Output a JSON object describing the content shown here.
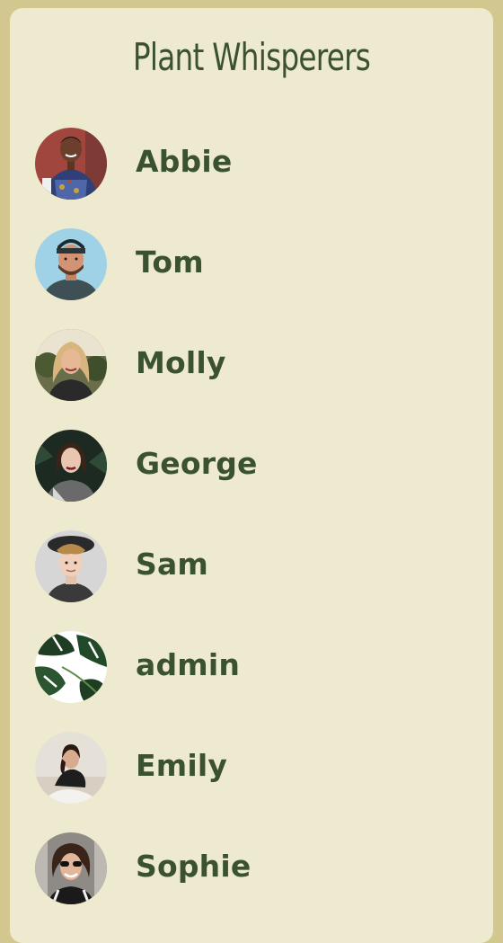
{
  "header": {
    "title": "Plant Whisperers"
  },
  "accent_color": "#3b5231",
  "background_color": "#eeead0",
  "border_color": "#d2c88f",
  "users": [
    {
      "name": "Abbie",
      "avatar": "abbie-avatar"
    },
    {
      "name": "Tom",
      "avatar": "tom-avatar"
    },
    {
      "name": "Molly",
      "avatar": "molly-avatar"
    },
    {
      "name": "George",
      "avatar": "george-avatar"
    },
    {
      "name": "Sam",
      "avatar": "sam-avatar"
    },
    {
      "name": "admin",
      "avatar": "monstera-leaf-avatar"
    },
    {
      "name": "Emily",
      "avatar": "emily-avatar"
    },
    {
      "name": "Sophie",
      "avatar": "sophie-avatar"
    }
  ]
}
